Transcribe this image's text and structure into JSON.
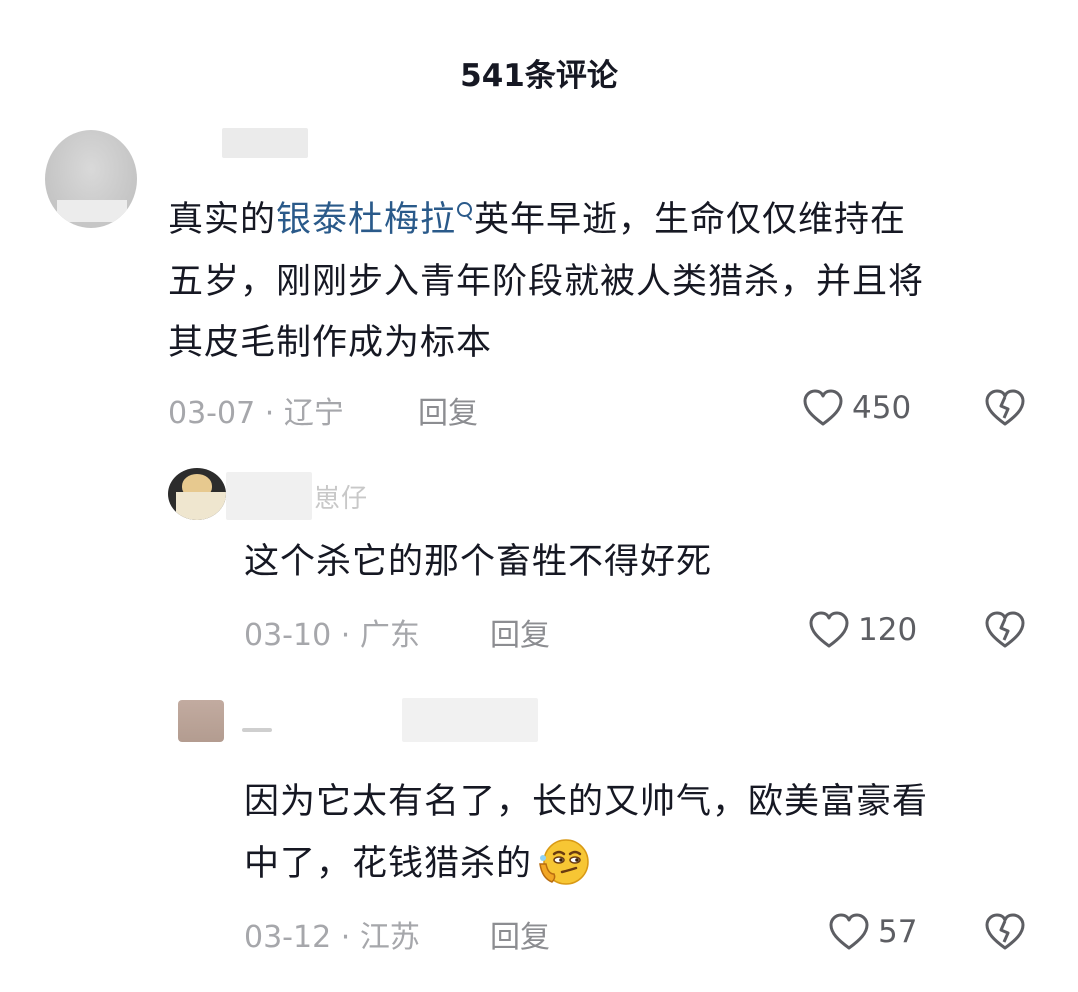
{
  "header": {
    "title": "541条评论"
  },
  "comments": [
    {
      "text_before": "真实的",
      "link": "银泰杜梅拉",
      "text_lines": [
        "英年早逝，生命仅仅维持在",
        "五岁，刚刚步入青年阶段就被人类猎杀，并且将",
        "其皮毛制作成为标本"
      ],
      "date": "03-07",
      "location": "辽宁",
      "reply_label": "回复",
      "likes": "450"
    }
  ],
  "replies": [
    {
      "name_fragment": "崽仔",
      "text": "这个杀它的那个畜牲不得好死",
      "date": "03-10",
      "location": "广东",
      "reply_label": "回复",
      "likes": "120"
    },
    {
      "text_lines": [
        "因为它太有名了，长的又帅气，欧美富豪看",
        "中了，花钱猎杀的"
      ],
      "emoji": "thinking-smirk-emoji",
      "date": "03-12",
      "location": "江苏",
      "reply_label": "回复",
      "likes": "57"
    }
  ],
  "colors": {
    "link": "#2a5a8a",
    "meta": "#a6a7ab",
    "text": "#161823"
  },
  "separator": "·"
}
